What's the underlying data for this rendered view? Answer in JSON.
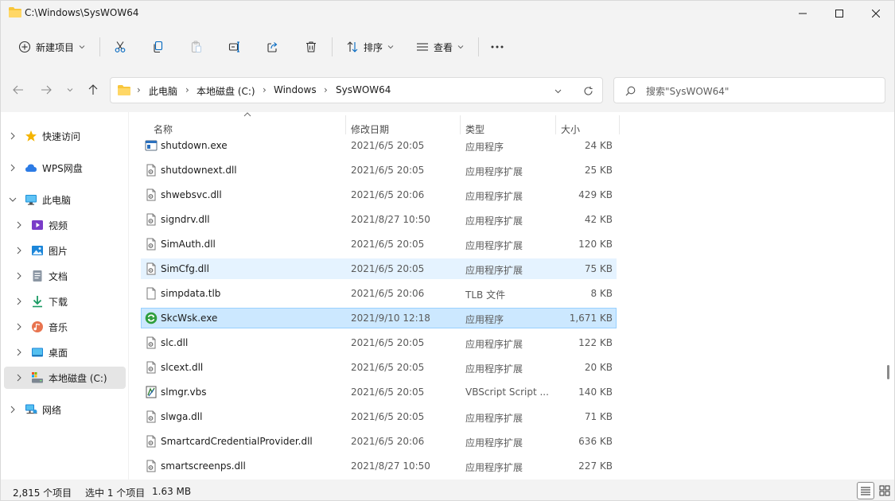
{
  "window": {
    "title": "C:\\Windows\\SysWOW64",
    "minimize_icon": "minimize-icon",
    "maximize_icon": "maximize-icon",
    "close_icon": "close-icon"
  },
  "toolbar": {
    "new_label": "新建项目",
    "sort_label": "排序",
    "view_label": "查看",
    "icons": [
      "cut-icon",
      "copy-icon",
      "paste-icon",
      "rename-icon",
      "share-icon",
      "delete-icon",
      "more-icon"
    ]
  },
  "address": {
    "crumbs": [
      "此电脑",
      "本地磁盘 (C:)",
      "Windows",
      "SysWOW64"
    ],
    "separator": "›"
  },
  "search": {
    "placeholder": "搜索\"SysWOW64\""
  },
  "sidebar": {
    "items": [
      {
        "label": "快速访问",
        "icon": "star-icon"
      },
      {
        "label": "WPS网盘",
        "icon": "cloud-icon"
      },
      {
        "label": "此电脑",
        "icon": "computer-icon"
      },
      {
        "label": "视频",
        "icon": "video-icon"
      },
      {
        "label": "图片",
        "icon": "pictures-icon"
      },
      {
        "label": "文档",
        "icon": "documents-icon"
      },
      {
        "label": "下载",
        "icon": "download-icon"
      },
      {
        "label": "音乐",
        "icon": "music-icon"
      },
      {
        "label": "桌面",
        "icon": "desktop-icon"
      },
      {
        "label": "本地磁盘 (C:)",
        "icon": "drive-icon"
      },
      {
        "label": "网络",
        "icon": "network-icon"
      }
    ]
  },
  "columns": {
    "name": "名称",
    "date": "修改日期",
    "type": "类型",
    "size": "大小"
  },
  "files": [
    {
      "name": "shutdown.exe",
      "date": "2021/6/5 20:05",
      "type": "应用程序",
      "size": "24 KB",
      "icon": "exe-icon"
    },
    {
      "name": "shutdownext.dll",
      "date": "2021/6/5 20:05",
      "type": "应用程序扩展",
      "size": "25 KB",
      "icon": "dll-icon"
    },
    {
      "name": "shwebsvc.dll",
      "date": "2021/6/5 20:06",
      "type": "应用程序扩展",
      "size": "429 KB",
      "icon": "dll-icon"
    },
    {
      "name": "signdrv.dll",
      "date": "2021/8/27 10:50",
      "type": "应用程序扩展",
      "size": "42 KB",
      "icon": "dll-icon"
    },
    {
      "name": "SimAuth.dll",
      "date": "2021/6/5 20:05",
      "type": "应用程序扩展",
      "size": "120 KB",
      "icon": "dll-icon"
    },
    {
      "name": "SimCfg.dll",
      "date": "2021/6/5 20:05",
      "type": "应用程序扩展",
      "size": "75 KB",
      "icon": "dll-icon"
    },
    {
      "name": "simpdata.tlb",
      "date": "2021/6/5 20:06",
      "type": "TLB 文件",
      "size": "8 KB",
      "icon": "file-icon"
    },
    {
      "name": "SkcWsk.exe",
      "date": "2021/9/10 12:18",
      "type": "应用程序",
      "size": "1,671 KB",
      "icon": "refresh-app-icon"
    },
    {
      "name": "slc.dll",
      "date": "2021/6/5 20:05",
      "type": "应用程序扩展",
      "size": "122 KB",
      "icon": "dll-icon"
    },
    {
      "name": "slcext.dll",
      "date": "2021/6/5 20:05",
      "type": "应用程序扩展",
      "size": "20 KB",
      "icon": "dll-icon"
    },
    {
      "name": "slmgr.vbs",
      "date": "2021/6/5 20:05",
      "type": "VBScript Script ...",
      "size": "140 KB",
      "icon": "script-icon"
    },
    {
      "name": "slwga.dll",
      "date": "2021/6/5 20:05",
      "type": "应用程序扩展",
      "size": "71 KB",
      "icon": "dll-icon"
    },
    {
      "name": "SmartcardCredentialProvider.dll",
      "date": "2021/6/5 20:06",
      "type": "应用程序扩展",
      "size": "636 KB",
      "icon": "dll-icon"
    },
    {
      "name": "smartscreenps.dll",
      "date": "2021/8/27 10:50",
      "type": "应用程序扩展",
      "size": "227 KB",
      "icon": "dll-icon"
    }
  ],
  "status": {
    "count": "2,815 个项目",
    "selection": "选中 1 个项目",
    "selection_size": "1.63 MB"
  },
  "colors": {
    "accent": "#0067c0",
    "selected_row": "#cce8ff",
    "hover_row": "#e5f3ff",
    "folder_yellow": "#f8c63b"
  }
}
